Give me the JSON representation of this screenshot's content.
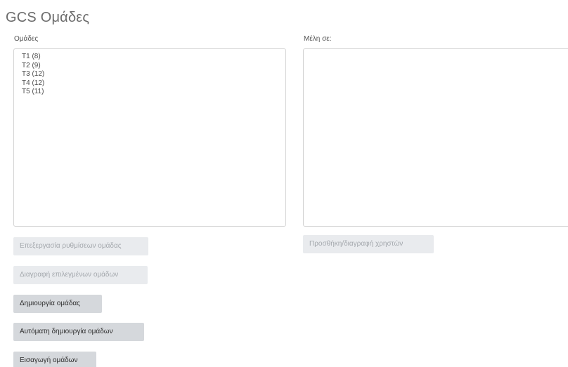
{
  "page": {
    "title": "GCS Ομάδες"
  },
  "groups": {
    "label": "Ομάδες",
    "options": [
      "Τ1 (8)",
      "Τ2 (9)",
      "Τ3 (12)",
      "Τ4 (12)",
      "Τ5 (11)"
    ]
  },
  "members": {
    "label": "Μέλη σε:",
    "options": []
  },
  "buttons": {
    "edit_settings": "Επεξεργασία ρυθμίσεων ομάδας",
    "delete_selected": "Διαγραφή επιλεγμένων ομάδων",
    "create_group": "Δημιουργία ομάδας",
    "auto_create": "Αυτόματη δημιουργία ομάδων",
    "import_groups": "Εισαγωγή ομάδων",
    "add_remove_users": "Προσθήκη/διαγραφή χρηστών"
  },
  "colors": {
    "enabled_button": "#d5d8dc",
    "disabled_button": "#e9ebee",
    "title": "#6b6b6b"
  }
}
